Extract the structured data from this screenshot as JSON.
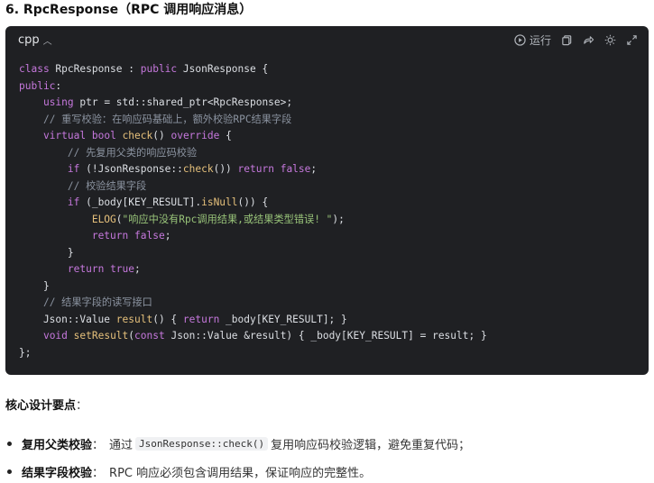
{
  "title": "6. RpcResponse（RPC 调用响应消息）",
  "code_block": {
    "language": "cpp",
    "run_label": "运行",
    "lines": [
      [
        {
          "t": "class",
          "c": "kw"
        },
        {
          "t": " RpcResponse : "
        },
        {
          "t": "public",
          "c": "kw"
        },
        {
          "t": " JsonResponse {"
        }
      ],
      [
        {
          "t": "public",
          "c": "kw"
        },
        {
          "t": ":"
        }
      ],
      [
        {
          "t": "    "
        },
        {
          "t": "using",
          "c": "kw"
        },
        {
          "t": " ptr = std::shared_ptr<RpcResponse>;"
        }
      ],
      [
        {
          "t": "    "
        },
        {
          "t": "// 重写校验：在响应码基础上，额外校验RPC结果字段",
          "c": "cm"
        }
      ],
      [
        {
          "t": "    "
        },
        {
          "t": "virtual",
          "c": "kw"
        },
        {
          "t": " "
        },
        {
          "t": "bool",
          "c": "kw"
        },
        {
          "t": " "
        },
        {
          "t": "check",
          "c": "fn"
        },
        {
          "t": "() "
        },
        {
          "t": "override",
          "c": "kw"
        },
        {
          "t": " {"
        }
      ],
      [
        {
          "t": "        "
        },
        {
          "t": "// 先复用父类的响应码校验",
          "c": "cm"
        }
      ],
      [
        {
          "t": "        "
        },
        {
          "t": "if",
          "c": "kw"
        },
        {
          "t": " (!JsonResponse::"
        },
        {
          "t": "check",
          "c": "fn"
        },
        {
          "t": "()) "
        },
        {
          "t": "return",
          "c": "kw"
        },
        {
          "t": " "
        },
        {
          "t": "false",
          "c": "kw"
        },
        {
          "t": ";"
        }
      ],
      [
        {
          "t": "        "
        },
        {
          "t": "// 校验结果字段",
          "c": "cm"
        }
      ],
      [
        {
          "t": "        "
        },
        {
          "t": "if",
          "c": "kw"
        },
        {
          "t": " (_body[KEY_RESULT]."
        },
        {
          "t": "isNull",
          "c": "fn"
        },
        {
          "t": "()) {"
        }
      ],
      [
        {
          "t": "            "
        },
        {
          "t": "ELOG",
          "c": "fn"
        },
        {
          "t": "("
        },
        {
          "t": "\"响应中没有Rpc调用结果,或结果类型错误! \"",
          "c": "str"
        },
        {
          "t": ");"
        }
      ],
      [
        {
          "t": "            "
        },
        {
          "t": "return",
          "c": "kw"
        },
        {
          "t": " "
        },
        {
          "t": "false",
          "c": "kw"
        },
        {
          "t": ";"
        }
      ],
      [
        {
          "t": "        }"
        }
      ],
      [
        {
          "t": "        "
        },
        {
          "t": "return",
          "c": "kw"
        },
        {
          "t": " "
        },
        {
          "t": "true",
          "c": "kw"
        },
        {
          "t": ";"
        }
      ],
      [
        {
          "t": "    }"
        }
      ],
      [
        {
          "t": "    "
        },
        {
          "t": "// 结果字段的读写接口",
          "c": "cm"
        }
      ],
      [
        {
          "t": "    Json::Value "
        },
        {
          "t": "result",
          "c": "fn"
        },
        {
          "t": "() { "
        },
        {
          "t": "return",
          "c": "kw"
        },
        {
          "t": " _body[KEY_RESULT]; }"
        }
      ],
      [
        {
          "t": "    "
        },
        {
          "t": "void",
          "c": "kw"
        },
        {
          "t": " "
        },
        {
          "t": "setResult",
          "c": "fn"
        },
        {
          "t": "("
        },
        {
          "t": "const",
          "c": "kw"
        },
        {
          "t": " Json::Value &result) { _body[KEY_RESULT] = result; }"
        }
      ],
      [
        {
          "t": "};"
        }
      ]
    ],
    "colors": {
      "kw": "#c678dd",
      "fn": "#e5c07b",
      "cm": "#8b93a0",
      "str": "#98c379",
      "bg": "#1f2023"
    }
  },
  "key_points": {
    "heading": "核心设计要点",
    "colon": "：",
    "items": [
      {
        "bold": "复用父类校验",
        "sep": "：",
        "pre": "通过",
        "code": "JsonResponse::check()",
        "post": "复用响应码校验逻辑，避免重复代码；"
      },
      {
        "bold": "结果字段校验",
        "sep": "：",
        "pre": "RPC 响应必须包含调用结果，保证响应的完整性。",
        "code": "",
        "post": ""
      }
    ]
  }
}
